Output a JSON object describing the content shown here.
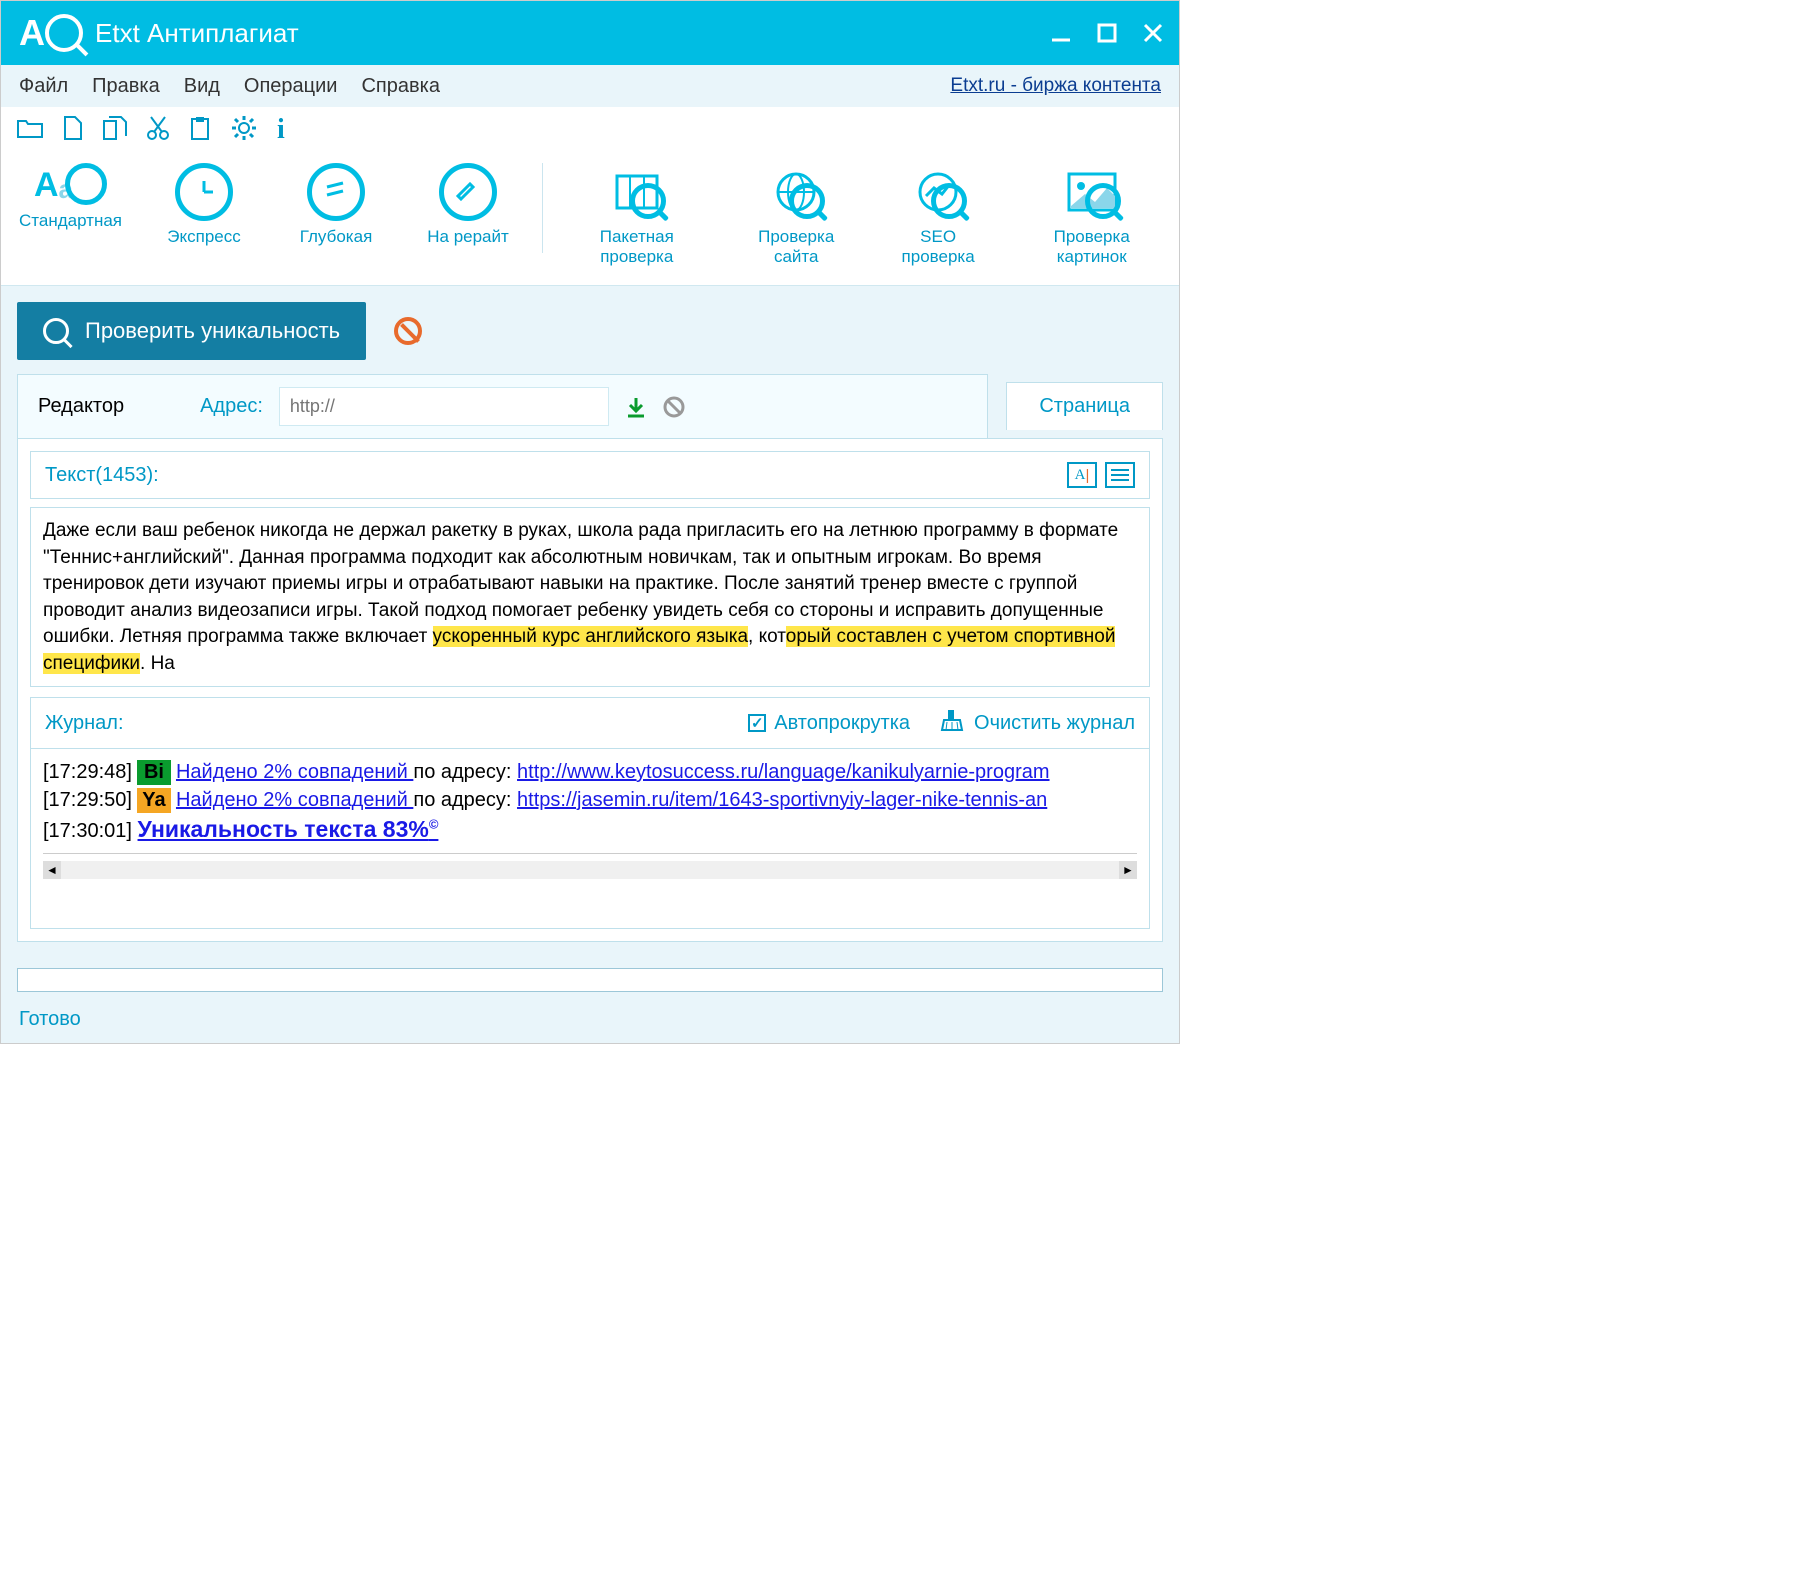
{
  "title": "Etxt Антиплагиат",
  "menubar": {
    "file": "Файл",
    "edit": "Правка",
    "view": "Вид",
    "ops": "Операции",
    "help": "Справка",
    "link": "Etxt.ru - биржа контента"
  },
  "bigtoolbar": {
    "left": [
      "Стандартная",
      "Экспресс",
      "Глубокая",
      "На рерайт"
    ],
    "right": [
      "Пакетная проверка",
      "Проверка сайта",
      "SEO проверка",
      "Проверка картинок"
    ]
  },
  "primary_label": "Проверить уникальность",
  "editor": {
    "tab1": "Редактор",
    "addr_label": "Адрес:",
    "addr_placeholder": "http://",
    "tab2": "Страница"
  },
  "textpanel": {
    "header": "Текст(1453):",
    "plain1": "Даже если ваш ребенок никогда не держал ракетку в руках, школа рада пригласить его на летнюю программу в формате \"Теннис+английский\". Данная программа подходит как абсолютным новичкам, так и опытным игрокам. Во время тренировок дети изучают приемы игры и отрабатывают навыки на практике. После занятий тренер вместе с группой проводит анализ видеозаписи игры. Такой подход помогает ребенку увидеть себя со стороны и исправить допущенные ошибки. Летняя программа также включает ",
    "hl1": "ускоренный курс английского языка",
    "plain2": ", кот",
    "hl2": "орый составлен с учетом спортивной специфики",
    "plain3": ". На"
  },
  "log": {
    "label": "Журнал:",
    "autoscroll": "Автопрокрутка",
    "clear": "Очистить журнал",
    "entries": [
      {
        "ts": "[17:29:48]",
        "badge": "Bi",
        "badgeClass": "bi",
        "found": "Найдено 2% совпадений ",
        "addr": "по адресу: ",
        "url": "http://www.keytosuccess.ru/language/kanikulyarnie-program"
      },
      {
        "ts": "[17:29:50]",
        "badge": "Ya",
        "badgeClass": "ya",
        "found": "Найдено 2% совпадений ",
        "addr": "по адресу: ",
        "url": "https://jasemin.ru/item/1643-sportivnyiy-lager-nike-tennis-an"
      }
    ],
    "result_ts": "[17:30:01] ",
    "result": "Уникальность текста 83%"
  },
  "status": "Готово"
}
